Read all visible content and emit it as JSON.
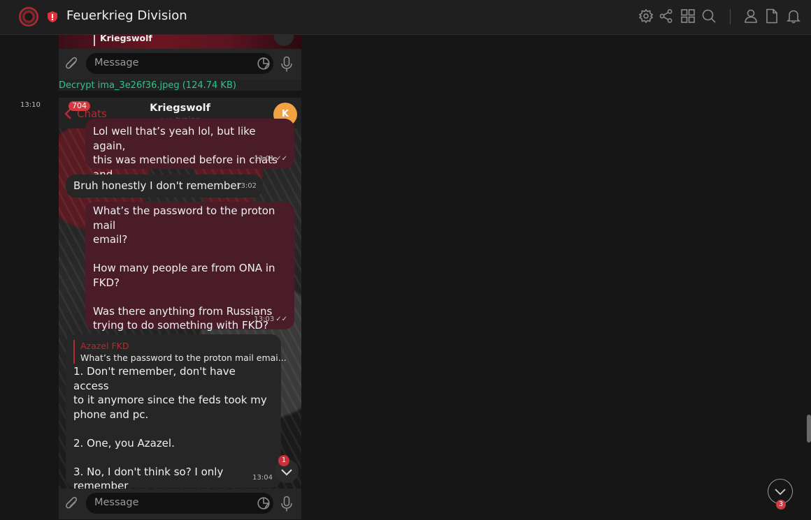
{
  "topbar": {
    "title": "Feuerkrieg Division",
    "icons": [
      "settings-icon",
      "share-icon",
      "grid-icon",
      "search-icon",
      "user-icon",
      "document-icon",
      "bell-icon"
    ]
  },
  "top_panel": {
    "reply_name": "Kriegswolf",
    "input_placeholder": "Message"
  },
  "attachment": {
    "decrypt_label": "Decrypt ima_3e26f36.jpeg (124.74 KB)"
  },
  "entry": {
    "timestamp": "13:10"
  },
  "chat": {
    "header": {
      "back_label": "Chats",
      "unread_count": "704",
      "contact_name": "Kriegswolf",
      "status": "••• typing",
      "avatar_initial": "K"
    },
    "messages": [
      {
        "dir": "out",
        "text": "Lol well that’s yeah lol, but like again,\nthis was mentioned before in chats and\nshit lol",
        "time": "13:01",
        "ticks": "✓✓"
      },
      {
        "dir": "in",
        "text": "Bruh honestly I don't remember",
        "time": "13:02"
      },
      {
        "dir": "out",
        "text": "What’s the password to the proton mail\nemail?\n\nHow many people are from ONA in\nFKD?\n\nWas there anything from Russians\ntrying to do something with FKD?",
        "time": "13:03",
        "ticks": "✓✓"
      },
      {
        "dir": "in",
        "reply_name": "Azazel FKD",
        "reply_text": "What’s the password to the proton mail emai...",
        "text": "1. Don't remember, don't have access\nto it anymore since the feds took my\nphone and pc.\n\n2. One, you Azazel.\n\n3. No, I don't think so? I only remember\none russian and he was inactive af",
        "time": "13:04"
      }
    ],
    "scroll_badge": "1",
    "input_placeholder": "Message"
  },
  "page": {
    "down_badge": "3"
  },
  "colors": {
    "accent_red": "#b52a33",
    "decrypt_green": "#2fc48a",
    "outgoing_bubble": "#4a1c27",
    "incoming_bubble": "#262626"
  }
}
